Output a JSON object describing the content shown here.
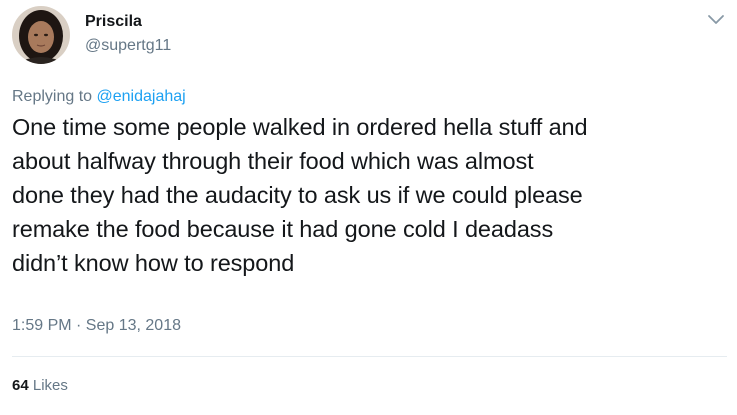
{
  "user": {
    "display_name": "Priscila",
    "handle": "@supertg11",
    "avatar_icon": "user-avatar-photo"
  },
  "reply": {
    "prefix": "Replying to",
    "mention": "@enidajahaj"
  },
  "tweet": {
    "lines": [
      "One time some people walked in ordered hella stuff and",
      "about halfway through their food which was almost",
      "done they had the audacity to ask us if we could please",
      "remake the food because it had gone cold I deadass",
      "didn’t know how to respond"
    ],
    "timestamp": "1:59 PM · Sep 13, 2018"
  },
  "stats": {
    "likes_count": "64",
    "likes_label": "Likes"
  },
  "icons": {
    "menu": "chevron-down-icon"
  },
  "colors": {
    "link": "#1da1f2",
    "secondary_text": "#657786",
    "primary_text": "#14171a",
    "divider": "#e6ecf0"
  }
}
